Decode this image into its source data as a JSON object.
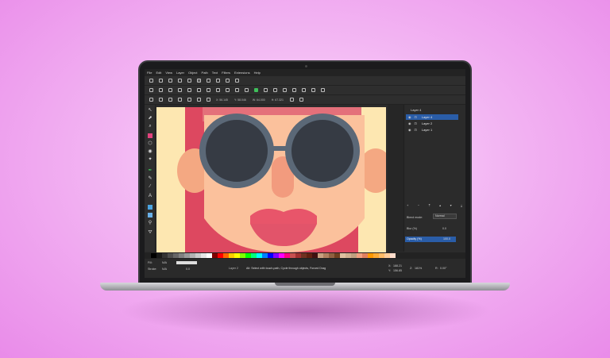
{
  "menu": [
    "File",
    "Edit",
    "View",
    "Layer",
    "Object",
    "Path",
    "Text",
    "Filters",
    "Extensions",
    "Help"
  ],
  "toolbar": {
    "x_label": "X:",
    "x_value": "56.145",
    "y_label": "Y:",
    "y_value": "58.046",
    "w_label": "W:",
    "w_value": "64.000",
    "h_label": "H:",
    "h_value": "67.321"
  },
  "layers": {
    "title": "Layer 4",
    "items": [
      {
        "name": "Layer 4",
        "selected": true
      },
      {
        "name": "Layer 2",
        "selected": false
      },
      {
        "name": "Layer 1",
        "selected": false
      }
    ]
  },
  "blend": {
    "label": "Blend mode:",
    "value": "Normal"
  },
  "blur": {
    "label": "Blur (%)",
    "value": "0.0"
  },
  "opacity": {
    "label": "Opacity (%)",
    "value": "100.0"
  },
  "status": {
    "fill_label": "Fill:",
    "fill_value": "N/A",
    "stroke_label": "Stroke:",
    "stroke_value": "N/A",
    "stroke_width": "0.0",
    "layer_select": "Layer 2",
    "message": "Alt: Select with touch-path, Cycle through objects, Forced Drag",
    "x_label": "X:",
    "x_value": "188.21",
    "y_label": "Y:",
    "y_value": "156.85",
    "zoom_label": "Z:",
    "zoom_value": "181%",
    "rot_label": "R:",
    "rot_value": "0.00°"
  },
  "palette": [
    "#000000",
    "#1a1a1a",
    "#333333",
    "#4d4d4d",
    "#666666",
    "#808080",
    "#999999",
    "#b3b3b3",
    "#cccccc",
    "#e6e6e6",
    "#ffffff",
    "#800000",
    "#ff0000",
    "#ff6600",
    "#ffcc00",
    "#ffff00",
    "#80ff00",
    "#00ff00",
    "#00ff80",
    "#00ffff",
    "#0080ff",
    "#0000ff",
    "#8000ff",
    "#ff00ff",
    "#ff0080",
    "#c85050",
    "#a03030",
    "#703020",
    "#602010",
    "#401010",
    "#c8a080",
    "#b08060",
    "#906040",
    "#704020",
    "#e0c0a0",
    "#d0b090",
    "#c0a080",
    "#f0a080",
    "#e08060",
    "#ff9900",
    "#ffaa33",
    "#ffbb66",
    "#ffcc99",
    "#ffddcc"
  ],
  "artwork": {
    "background": "#fde7b1",
    "hair": "#dd4860",
    "hair_top": "#e4707a",
    "skin": "#fbc19c",
    "ear": "#f4a882",
    "lens": "#363b44",
    "frame": "#5b6877",
    "nose": "#f29b7e",
    "lips_top": "#e8556a",
    "lips_bottom": "#e2546a"
  }
}
